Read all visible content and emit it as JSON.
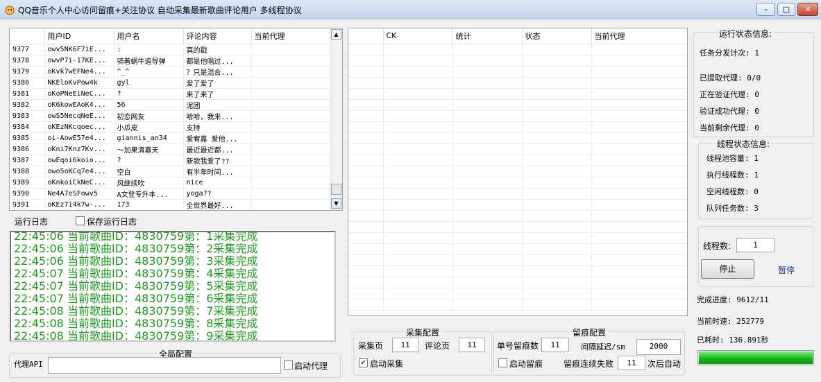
{
  "window": {
    "title": "QQ音乐个人中心访问留痕+关注协议 自动采集最新歌曲评论用户 多线程协议",
    "min_label": "–",
    "max_label": "□",
    "close_label": "✕"
  },
  "user_grid": {
    "columns": [
      "",
      "用户ID",
      "用户名",
      "评论内容",
      "当前代理"
    ],
    "rows": [
      [
        "9377",
        "owv5NK6F7iE...",
        ":",
        "真的戳",
        ""
      ],
      [
        "9378",
        "owvP7i-17KE...",
        "骑着蜗牛追导弹",
        "都是他唱过...",
        ""
      ],
      [
        "9379",
        "oKvk7wEFNe4...",
        "^_^",
        "？只是混合...",
        ""
      ],
      [
        "9380",
        "NKEloKvPow4k",
        "gyl",
        "爱了爱了",
        ""
      ],
      [
        "9381",
        "oKoPNeEiNeC...",
        "?",
        "来了来了",
        ""
      ],
      [
        "9382",
        "oK6kowEAoK4...",
        "56",
        "泥团",
        ""
      ],
      [
        "9383",
        "owS5NecqNeE...",
        "初恋网友",
        "哈哈，我来...",
        ""
      ],
      [
        "9384",
        "oKEzNKcqoec...",
        "小瓜皮",
        "支持",
        ""
      ],
      [
        "9385",
        "oi-AowE57e4...",
        "giannis_an34",
        "爱宥嘉 爱他...",
        ""
      ],
      [
        "9386",
        "oKni7Knz7Kv...",
        "～加果淯嘉天",
        "最近最近都...",
        ""
      ],
      [
        "9387",
        "owEqoi6koio...",
        "?",
        "新歌我爱了??",
        ""
      ],
      [
        "9388",
        "owo5oKCq7e4...",
        "空白",
        "有半年时间...",
        ""
      ],
      [
        "9389",
        "oKnkoiCkNeC...",
        "风继续吹",
        "nice",
        ""
      ],
      [
        "9390",
        "Ne4A7eSFowv5",
        "A文登专升本...",
        "yoga??",
        ""
      ],
      [
        "9391",
        "oKEz7i4k7w-...",
        "173",
        "全世界最好...",
        ""
      ]
    ],
    "scroll_up": "▲",
    "scroll_down": "▼"
  },
  "ck_grid": {
    "columns": [
      "",
      "CK",
      "统计",
      "状态",
      "当前代理"
    ]
  },
  "log": {
    "tab_label": "运行日志",
    "save_label": "保存运行日志",
    "save_checked": false,
    "lines": [
      "22:45:06 当前歌曲ID：4830759第：1采集完成",
      "22:45:06 当前歌曲ID：4830759第：2采集完成",
      "22:45:06 当前歌曲ID：4830759第：3采集完成",
      "22:45:07 当前歌曲ID：4830759第：4采集完成",
      "22:45:07 当前歌曲ID：4830759第：5采集完成",
      "22:45:07 当前歌曲ID：4830759第：6采集完成",
      "22:45:08 当前歌曲ID：4830759第：7采集完成",
      "22:45:08 当前歌曲ID：4830759第：8采集完成",
      "22:45:08 当前歌曲ID：4830759第：9采集完成"
    ]
  },
  "global_config": {
    "title": "全局配置",
    "proxy_api_label": "代理API",
    "proxy_api_value": "",
    "enable_proxy_label": "启动代理",
    "enable_proxy_checked": false
  },
  "collect_config": {
    "title": "采集配置",
    "pages_label": "采集页",
    "pages_value": "11",
    "comment_pages_label": "评论页",
    "comment_pages_value": "11",
    "enable_label": "启动采集",
    "enable_checked": true
  },
  "trace_config": {
    "title": "留痕配置",
    "per_account_label": "单号留痕数",
    "per_account_value": "11",
    "interval_label": "间隔延迟/sm",
    "interval_value": "2000",
    "enable_label": "启动留痕",
    "enable_checked": false,
    "fail_label": "留痕连续失败",
    "fail_value": "11",
    "fail_suffix": "次后自动"
  },
  "status_panel": {
    "title": "运行状态信息:",
    "dispatch_count": "任务分发计次: 1",
    "fetched_proxy": "已提取代理: 0/0",
    "verifying_proxy": "正在验证代理: 0",
    "verified_proxy": "验证成功代理: 0",
    "remaining_proxy": "当前剩余代理: 0"
  },
  "thread_panel": {
    "title": "线程状态信息:",
    "pool_capacity": "线程池容量: 1",
    "running_threads": "执行线程数: 1",
    "idle_threads": "空闲线程数: 0",
    "queued_tasks": "队列任务数: 3"
  },
  "controls": {
    "thread_count_label": "线程数:",
    "thread_count_value": "1",
    "stop_label": "停止",
    "pause_label": "暂停",
    "pause_color": "#1a3a9a"
  },
  "progress": {
    "completion": "完成进度: 9612/11",
    "speed": "当前时速: 252779",
    "elapsed": "已耗时: 136.891秒",
    "fill_fraction": 1.0,
    "color": "#10b010"
  }
}
